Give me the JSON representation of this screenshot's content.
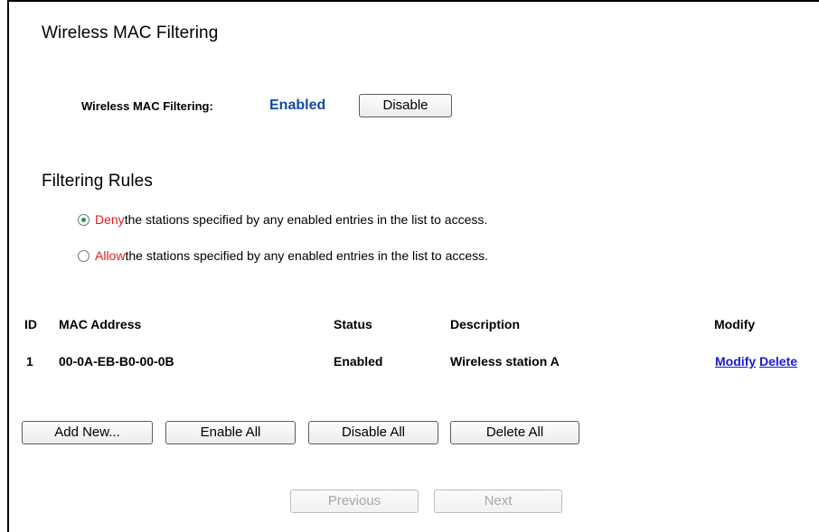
{
  "section": {
    "title": "Wireless MAC Filtering",
    "status_label": "Wireless MAC Filtering:",
    "status_value": "Enabled",
    "disable_button": "Disable"
  },
  "rules": {
    "title": "Filtering Rules",
    "deny": {
      "keyword": "Deny",
      "text": " the stations specified by any enabled entries in the list to access.",
      "checked": true
    },
    "allow": {
      "keyword": "Allow",
      "text": " the stations specified by any enabled entries in the list to access.",
      "checked": false
    }
  },
  "table": {
    "headers": [
      "ID",
      "MAC Address",
      "Status",
      "Description",
      "Modify"
    ],
    "rows": [
      {
        "id": "1",
        "mac": "00-0A-EB-B0-00-0B",
        "status": "Enabled",
        "description": "Wireless station A",
        "modify": "Modify",
        "delete": "Delete"
      }
    ]
  },
  "actions": {
    "add_new": "Add New...",
    "enable_all": "Enable All",
    "disable_all": "Disable All",
    "delete_all": "Delete All"
  },
  "pager": {
    "previous": "Previous",
    "next": "Next"
  },
  "colors": {
    "status_blue": "#0f4aa3",
    "keyword_red": "#e01c1c",
    "link_blue": "#1a1ad6"
  }
}
